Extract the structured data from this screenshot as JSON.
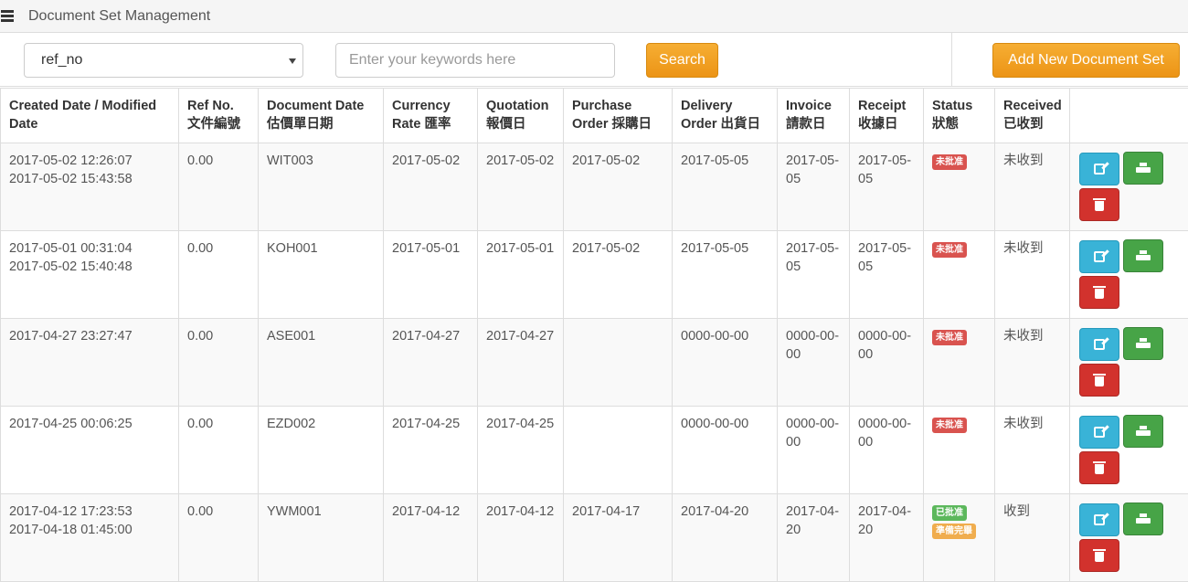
{
  "header": {
    "title": "Document Set Management",
    "icon": "list-icon"
  },
  "toolbar": {
    "field_select_value": "ref_no",
    "search_placeholder": "Enter your keywords here",
    "search_label": "Search",
    "add_label": "Add New Document Set"
  },
  "table": {
    "columns": [
      "Created Date / Modified Date",
      "Ref No. 文件編號",
      "Document Date 估價單日期",
      "Currency Rate 匯率",
      "Quotation 報價日",
      "Purchase Order 採購日",
      "Delivery Order 出貨日",
      "Invoice 請款日",
      "Receipt 收據日",
      "Status 狀態",
      "Received 已收到",
      ""
    ],
    "rows": [
      {
        "created": "2017-05-02 12:26:07",
        "modified": "2017-05-02 15:43:58",
        "ref_no": "0.00",
        "doc_date": "WIT003",
        "currency": "2017-05-02",
        "quotation": "2017-05-02",
        "purchase": "2017-05-02",
        "delivery": "2017-05-05",
        "invoice": "2017-05-05",
        "receipt": "2017-05-05",
        "status1": "未批准",
        "status2": "",
        "received": "未收到"
      },
      {
        "created": "2017-05-01 00:31:04",
        "modified": "2017-05-02 15:40:48",
        "ref_no": "0.00",
        "doc_date": "KOH001",
        "currency": "2017-05-01",
        "quotation": "2017-05-01",
        "purchase": "2017-05-02",
        "delivery": "2017-05-05",
        "invoice": "2017-05-05",
        "receipt": "2017-05-05",
        "status1": "未批准",
        "status2": "",
        "received": "未收到"
      },
      {
        "created": "2017-04-27 23:27:47",
        "modified": "",
        "ref_no": "0.00",
        "doc_date": "ASE001",
        "currency": "2017-04-27",
        "quotation": "2017-04-27",
        "purchase": "",
        "delivery": "0000-00-00",
        "invoice": "0000-00-00",
        "receipt": "0000-00-00",
        "status1": "未批准",
        "status2": "",
        "received": "未收到"
      },
      {
        "created": "2017-04-25 00:06:25",
        "modified": "",
        "ref_no": "0.00",
        "doc_date": "EZD002",
        "currency": "2017-04-25",
        "quotation": "2017-04-25",
        "purchase": "",
        "delivery": "0000-00-00",
        "invoice": "0000-00-00",
        "receipt": "0000-00-00",
        "status1": "未批准",
        "status2": "",
        "received": "未收到"
      },
      {
        "created": "2017-04-12 17:23:53",
        "modified": "2017-04-18 01:45:00",
        "ref_no": "0.00",
        "doc_date": "YWM001",
        "currency": "2017-04-12",
        "quotation": "2017-04-12",
        "purchase": "2017-04-17",
        "delivery": "2017-04-20",
        "invoice": "2017-04-20",
        "receipt": "2017-04-20",
        "status1": "已批准",
        "status2": "準備完畢",
        "received": "收到"
      }
    ]
  },
  "colors": {
    "accent_orange": "#f0a023",
    "edit_blue": "#39b3d7",
    "print_green": "#47a447",
    "delete_red": "#d2322d",
    "badge_red": "#d9534f",
    "badge_green": "#5cb85c",
    "badge_yellow": "#f0ad4e"
  },
  "action_icons": {
    "edit": "edit-icon",
    "print": "print-icon",
    "delete": "trash-icon"
  }
}
